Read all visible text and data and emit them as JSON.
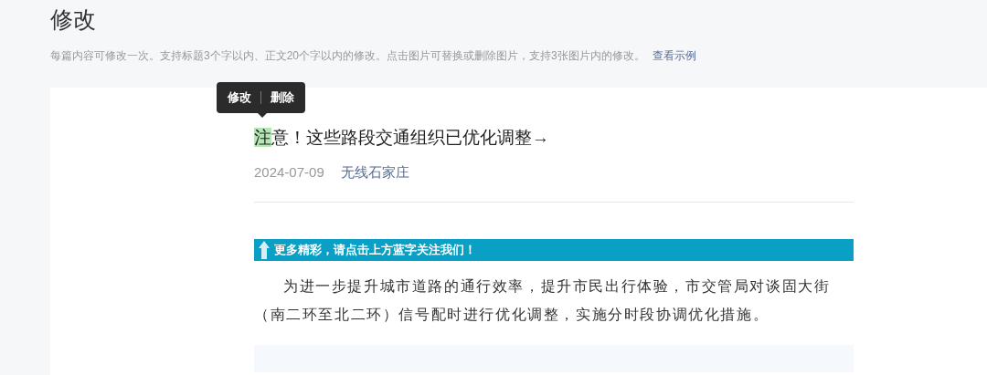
{
  "page_title": "修改",
  "notice": {
    "text": "每篇内容可修改一次。支持标题3个字以内、正文20个字以内的修改。点击图片可替换或删除图片，支持3张图片内的修改。",
    "link": "查看示例"
  },
  "tooltip": {
    "actions": [
      "修改",
      "删除"
    ]
  },
  "article": {
    "title": {
      "highlighted": "注",
      "rest": "意！这些路段交通组织已优化调整→"
    },
    "date": "2024-07-09",
    "author": "无线石家庄",
    "banner": "更多精彩，请点击上方蓝字关注我们！",
    "paragraph": "为进一步提升城市道路的通行效率，提升市民出行体验，市交管局对谈固大街（南二环至北二环）信号配时进行优化调整，实施分时段协调优化措施。"
  }
}
